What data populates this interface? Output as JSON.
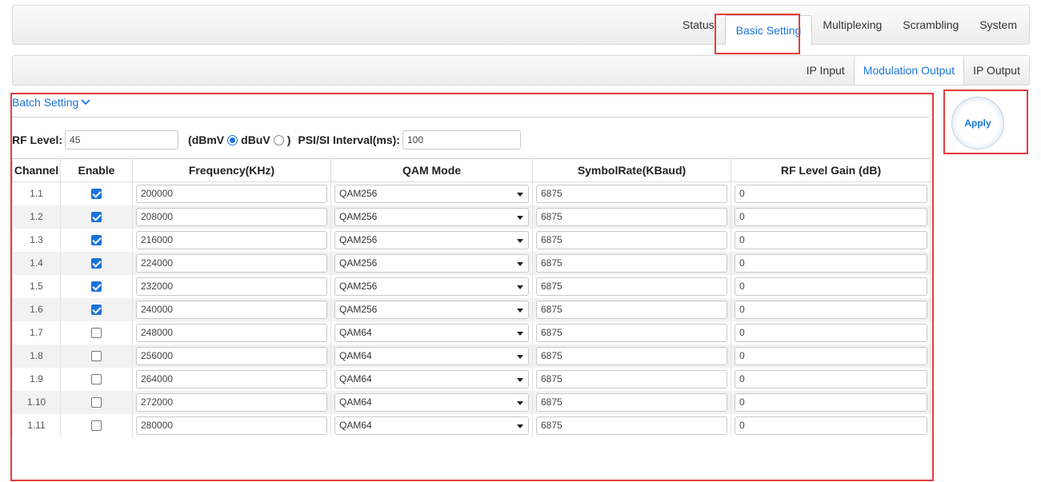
{
  "top_nav": {
    "items": [
      {
        "label": "Status",
        "active": false
      },
      {
        "label": "Basic Setting",
        "active": true
      },
      {
        "label": "Multiplexing",
        "active": false
      },
      {
        "label": "Scrambling",
        "active": false
      },
      {
        "label": "System",
        "active": false
      }
    ]
  },
  "sub_nav": {
    "items": [
      {
        "label": "IP Input",
        "active": false
      },
      {
        "label": "Modulation Output",
        "active": true
      },
      {
        "label": "IP Output",
        "active": false
      }
    ]
  },
  "batch_setting": {
    "label": "Batch Setting",
    "icon": "chevron-down-icon"
  },
  "rf": {
    "level_label": "RF Level:",
    "level_value": "45",
    "open_paren": "(",
    "unit_dbmv": "dBmV",
    "unit_dbuv": "dBuV",
    "close_paren": ")",
    "selected_unit": "dBmV",
    "psi_label": "PSI/SI Interval(ms):",
    "psi_value": "100"
  },
  "apply": {
    "label": "Apply"
  },
  "table": {
    "headers": [
      "Channel",
      "Enable",
      "Frequency(KHz)",
      "QAM Mode",
      "SymbolRate(KBaud)",
      "RF Level Gain (dB)"
    ],
    "rows": [
      {
        "channel": "1.1",
        "enabled": true,
        "frequency": "200000",
        "qam": "QAM256",
        "symbol_rate": "6875",
        "gain": "0"
      },
      {
        "channel": "1.2",
        "enabled": true,
        "frequency": "208000",
        "qam": "QAM256",
        "symbol_rate": "6875",
        "gain": "0"
      },
      {
        "channel": "1.3",
        "enabled": true,
        "frequency": "216000",
        "qam": "QAM256",
        "symbol_rate": "6875",
        "gain": "0"
      },
      {
        "channel": "1.4",
        "enabled": true,
        "frequency": "224000",
        "qam": "QAM256",
        "symbol_rate": "6875",
        "gain": "0"
      },
      {
        "channel": "1.5",
        "enabled": true,
        "frequency": "232000",
        "qam": "QAM256",
        "symbol_rate": "6875",
        "gain": "0"
      },
      {
        "channel": "1.6",
        "enabled": true,
        "frequency": "240000",
        "qam": "QAM256",
        "symbol_rate": "6875",
        "gain": "0"
      },
      {
        "channel": "1.7",
        "enabled": false,
        "frequency": "248000",
        "qam": "QAM64",
        "symbol_rate": "6875",
        "gain": "0"
      },
      {
        "channel": "1.8",
        "enabled": false,
        "frequency": "256000",
        "qam": "QAM64",
        "symbol_rate": "6875",
        "gain": "0"
      },
      {
        "channel": "1.9",
        "enabled": false,
        "frequency": "264000",
        "qam": "QAM64",
        "symbol_rate": "6875",
        "gain": "0"
      },
      {
        "channel": "1.10",
        "enabled": false,
        "frequency": "272000",
        "qam": "QAM64",
        "symbol_rate": "6875",
        "gain": "0"
      },
      {
        "channel": "1.11",
        "enabled": false,
        "frequency": "280000",
        "qam": "QAM64",
        "symbol_rate": "6875",
        "gain": "0"
      }
    ]
  },
  "colors": {
    "accent": "#1a73d9",
    "highlight": "#e8393b"
  }
}
